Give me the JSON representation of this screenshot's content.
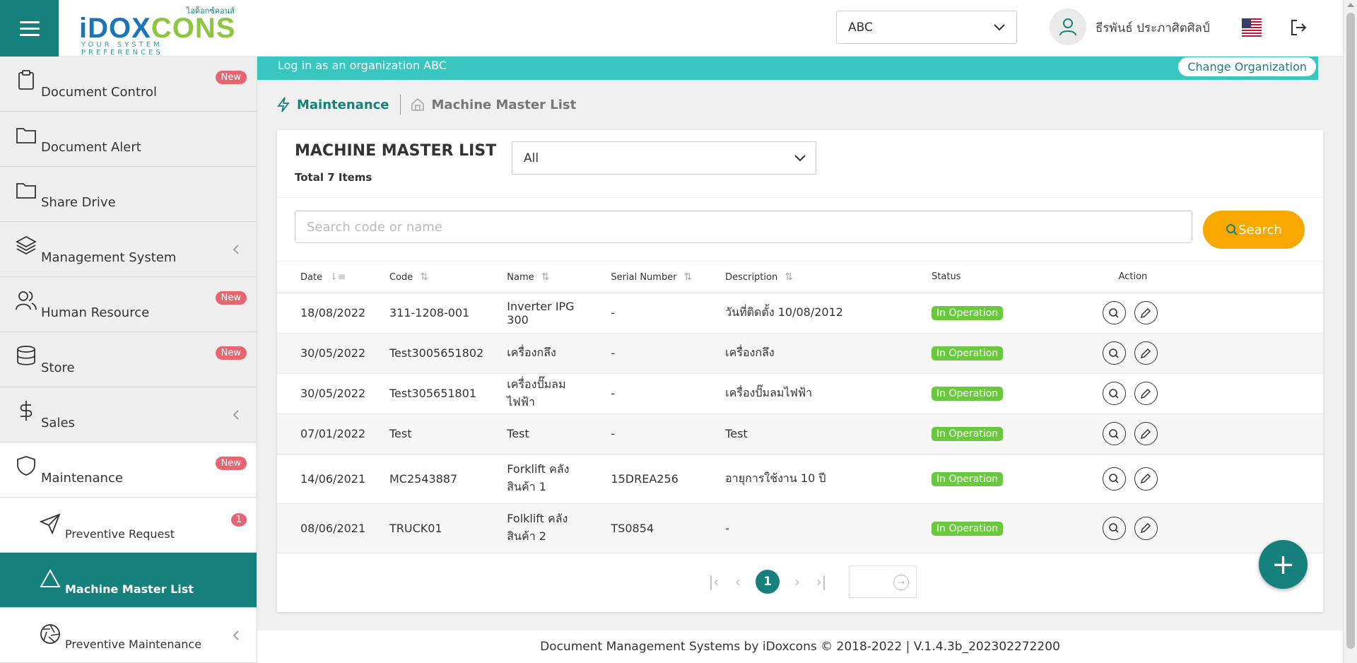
{
  "header": {
    "logo_thai": "ไอด็อกซ์คอนส์",
    "logo_i": "i",
    "logo_dox": "DOX",
    "logo_cons": "CONS",
    "logo_tagline": "YOUR SYSTEM PREFERENCES",
    "org_selected": "ABC",
    "user_name": "ธีรพันธ์ ประภาศิตศิลป์"
  },
  "sidebar": {
    "items": [
      {
        "label": "Document Control",
        "badge": "New"
      },
      {
        "label": "Document Alert"
      },
      {
        "label": "Share Drive"
      },
      {
        "label": "Management System"
      },
      {
        "label": "Human Resource",
        "badge": "New"
      },
      {
        "label": "Store",
        "badge": "New"
      },
      {
        "label": "Sales"
      },
      {
        "label": "Maintenance",
        "badge": "New"
      },
      {
        "label": "Preventive Request",
        "badge": "1"
      },
      {
        "label": "Machine Master List"
      },
      {
        "label": "Preventive Maintenance"
      }
    ]
  },
  "orgbar": {
    "text": "Log in as an organization ABC",
    "button": "Change Organization"
  },
  "breadcrumb": {
    "section": "Maintenance",
    "page": "Machine Master List"
  },
  "card": {
    "title": "MACHINE MASTER LIST",
    "total": "Total 7 Items",
    "filter_selected": "All",
    "search_placeholder": "Search code or name",
    "search_button": "Search"
  },
  "table": {
    "columns": [
      "Date",
      "Code",
      "Name",
      "Serial Number",
      "Description",
      "Status",
      "Action"
    ],
    "rows": [
      {
        "date": "18/08/2022",
        "code": "311-1208-001",
        "name": "Inverter IPG 300",
        "serial": "-",
        "description": "วันที่ติดตั้ง 10/08/2012",
        "status": "In Operation"
      },
      {
        "date": "30/05/2022",
        "code": "Test3005651802",
        "name": "เครื่องกลึง",
        "serial": "-",
        "description": "เครื่องกลึง",
        "status": "In Operation"
      },
      {
        "date": "30/05/2022",
        "code": "Test305651801",
        "name": "เครื่องปั๊มลมไฟฟ้า",
        "serial": "-",
        "description": "เครื่องปั๊มลมไฟฟ้า",
        "status": "In Operation"
      },
      {
        "date": "07/01/2022",
        "code": "Test",
        "name": "Test",
        "serial": "-",
        "description": "Test",
        "status": "In Operation"
      },
      {
        "date": "14/06/2021",
        "code": "MC2543887",
        "name": "Forklift คลังสินค้า 1",
        "serial": "15DREA256",
        "description": "อายุการใช้งาน 10 ปี",
        "status": "In Operation"
      },
      {
        "date": "08/06/2021",
        "code": "TRUCK01",
        "name": "Folklift คลังสินค้า 2",
        "serial": "TS0854",
        "description": "-",
        "status": "In Operation"
      }
    ]
  },
  "pager": {
    "current_page": "1"
  },
  "footer": {
    "text": "Document Management Systems by iDoxcons © 2018-2022  |  V.1.4.3b_202302272200"
  },
  "colors": {
    "primary": "#16807c",
    "orgbar": "#39c6c0",
    "search": "#f9a800",
    "status": "#68c93d",
    "badge": "#e8656f"
  }
}
